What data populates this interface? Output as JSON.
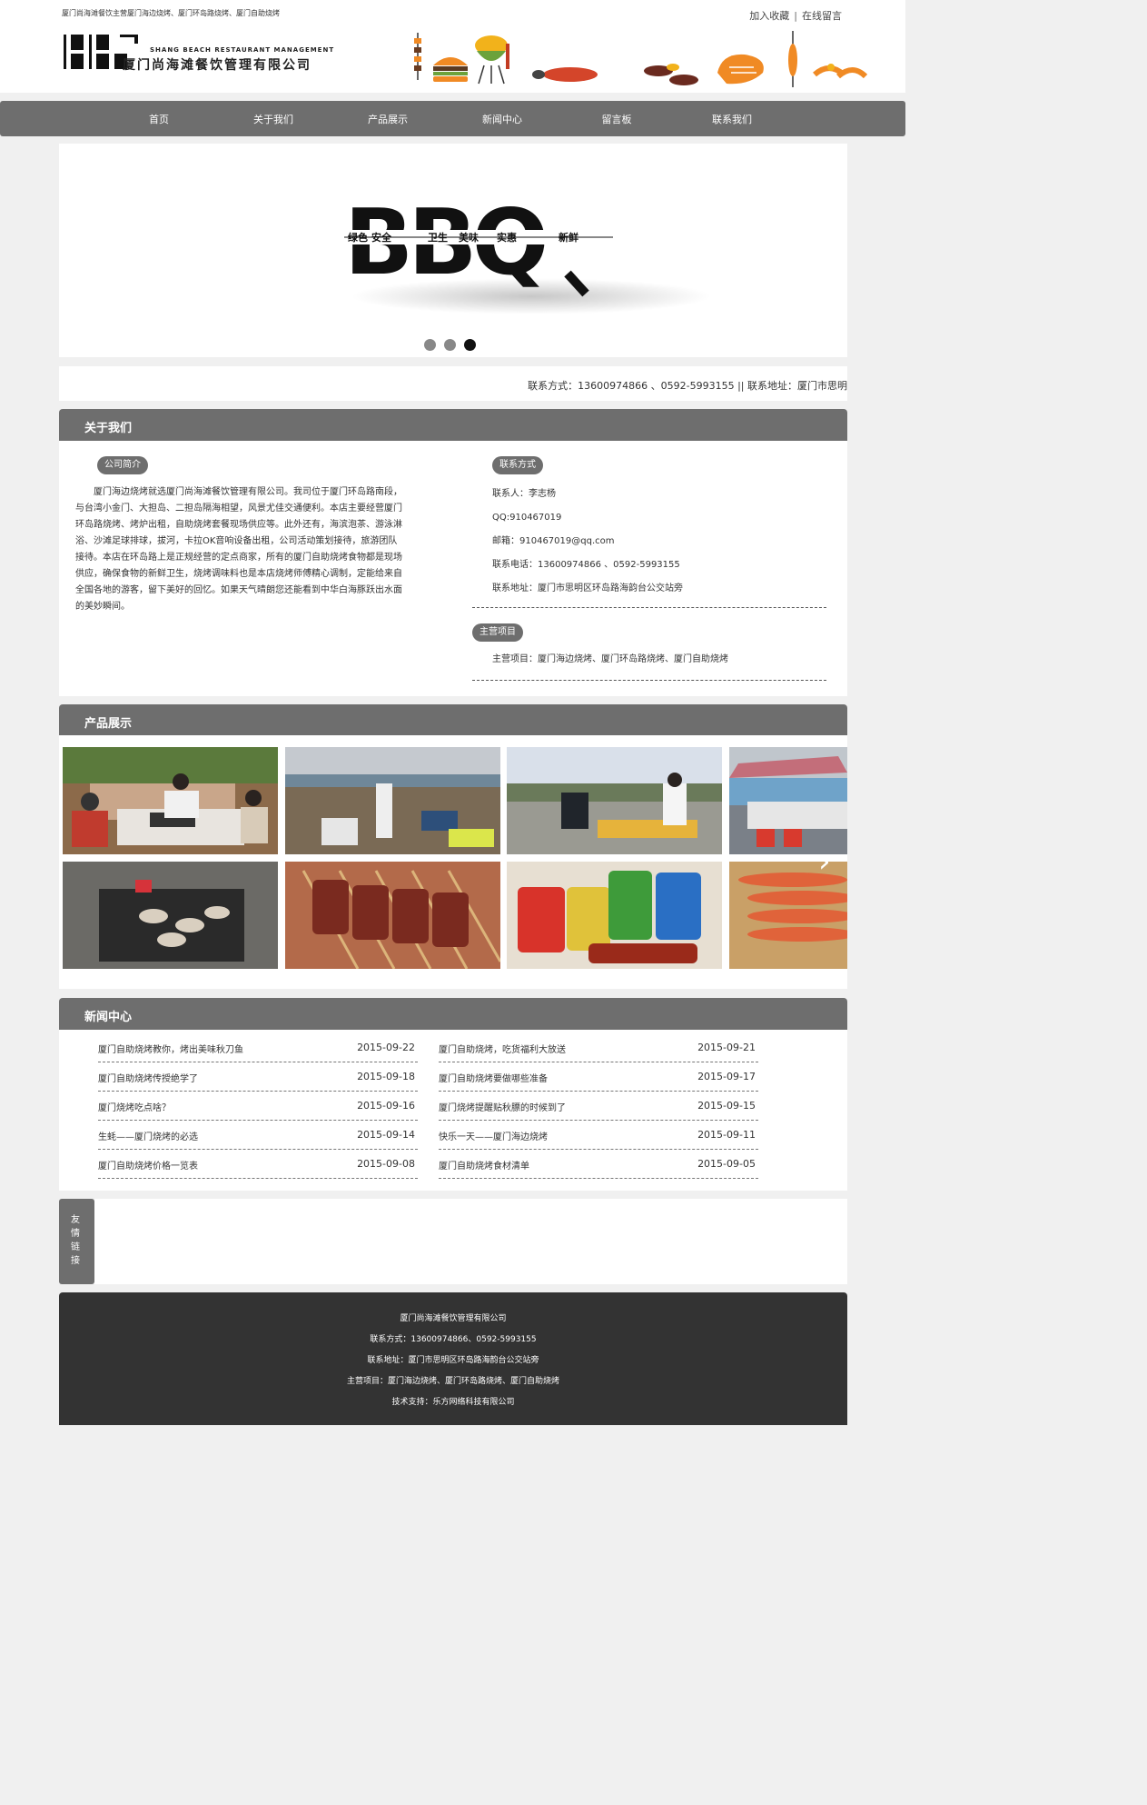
{
  "header": {
    "slogan": "厦门尚海滩餐饮主营厦门海边烧烤、厦门环岛路烧烤、厦门自助烧烤",
    "bookmark_label": "加入收藏",
    "separator": "|",
    "message_label": "在线留言",
    "logo_en": "SHANG BEACH RESTAURANT MANAGEMENT",
    "logo_cn": "厦门尚海滩餐饮管理有限公司"
  },
  "nav": {
    "items": [
      "首页",
      "关于我们",
      "产品展示",
      "新闻中心",
      "留言板",
      "联系我们"
    ]
  },
  "banner": {
    "logo_text": "BBQ",
    "words": [
      "绿色",
      "安全",
      "卫生",
      "美味",
      "实惠",
      "新鲜"
    ],
    "slide_count": 3,
    "active_slide": 3
  },
  "contact_bar": {
    "text": "联系方式：13600974866 、0592-5993155    ||    联系地址：厦门市思明"
  },
  "about": {
    "title": "关于我们",
    "intro_label": "公司简介",
    "intro_text": "厦门海边烧烤就选厦门尚海滩餐饮管理有限公司。我司位于厦门环岛路南段，与台湾小金门、大担岛、二担岛隔海相望，风景尤佳交通便利。本店主要经营厦门环岛路烧烤、烤炉出租，自助烧烤套餐现场供应等。此外还有，海滨泡茶、游泳淋浴、沙滩足球排球，拔河，卡拉OK音响设备出租，公司活动策划接待，旅游团队接待。本店在环岛路上是正规经营的定点商家，所有的厦门自助烧烤食物都是现场供应，确保食物的新鲜卫生，烧烤调味料也是本店烧烤师傅精心调制，定能给来自全国各地的游客，留下美好的回忆。如果天气晴朗您还能看到中华白海豚跃出水面的美妙瞬间。",
    "contact_label": "联系方式",
    "contact_person": "联系人：李志杨",
    "qq": "QQ:910467019",
    "email": "邮箱：910467019@qq.com",
    "phone": "联系电话：13600974866 、0592-5993155",
    "address": "联系地址：厦门市思明区环岛路海韵台公交站旁",
    "business_label": "主营项目",
    "business": "主营项目：厦门海边烧烤、厦门环岛路烧烤、厦门自助烧烤"
  },
  "products": {
    "title": "产品展示",
    "arrow_icon": "chevron-right-icon"
  },
  "news": {
    "title": "新闻中心",
    "items": [
      {
        "title": "厦门自助烧烤教你，烤出美味秋刀鱼",
        "date": "2015-09-22"
      },
      {
        "title": "厦门自助烧烤，吃货福利大放送",
        "date": "2015-09-21"
      },
      {
        "title": "厦门自助烧烤传授绝学了",
        "date": "2015-09-18"
      },
      {
        "title": "厦门自助烧烤要做哪些准备",
        "date": "2015-09-17"
      },
      {
        "title": "厦门烧烤吃点啥？",
        "date": "2015-09-16"
      },
      {
        "title": "厦门烧烤提醒贴秋膘的时候到了",
        "date": "2015-09-15"
      },
      {
        "title": "生蚝——厦门烧烤的必选",
        "date": "2015-09-14"
      },
      {
        "title": "快乐一天——厦门海边烧烤",
        "date": "2015-09-11"
      },
      {
        "title": "厦门自助烧烤价格一览表",
        "date": "2015-09-08"
      },
      {
        "title": "厦门自助烧烤食材清单",
        "date": "2015-09-05"
      }
    ]
  },
  "friend_links": {
    "label": "友情链接"
  },
  "footer": {
    "company": "厦门尚海滩餐饮管理有限公司",
    "contact": "联系方式：13600974866、0592-5993155",
    "address": "联系地址：厦门市思明区环岛路海韵台公交站旁",
    "business": "主营项目：厦门海边烧烤、厦门环岛路烧烤、厦门自助烧烤",
    "support": "技术支持：乐方网络科技有限公司"
  },
  "colors": {
    "nav_bg": "#6e6e6e",
    "footer_bg": "#333333",
    "page_bg": "#f0f0f0"
  }
}
